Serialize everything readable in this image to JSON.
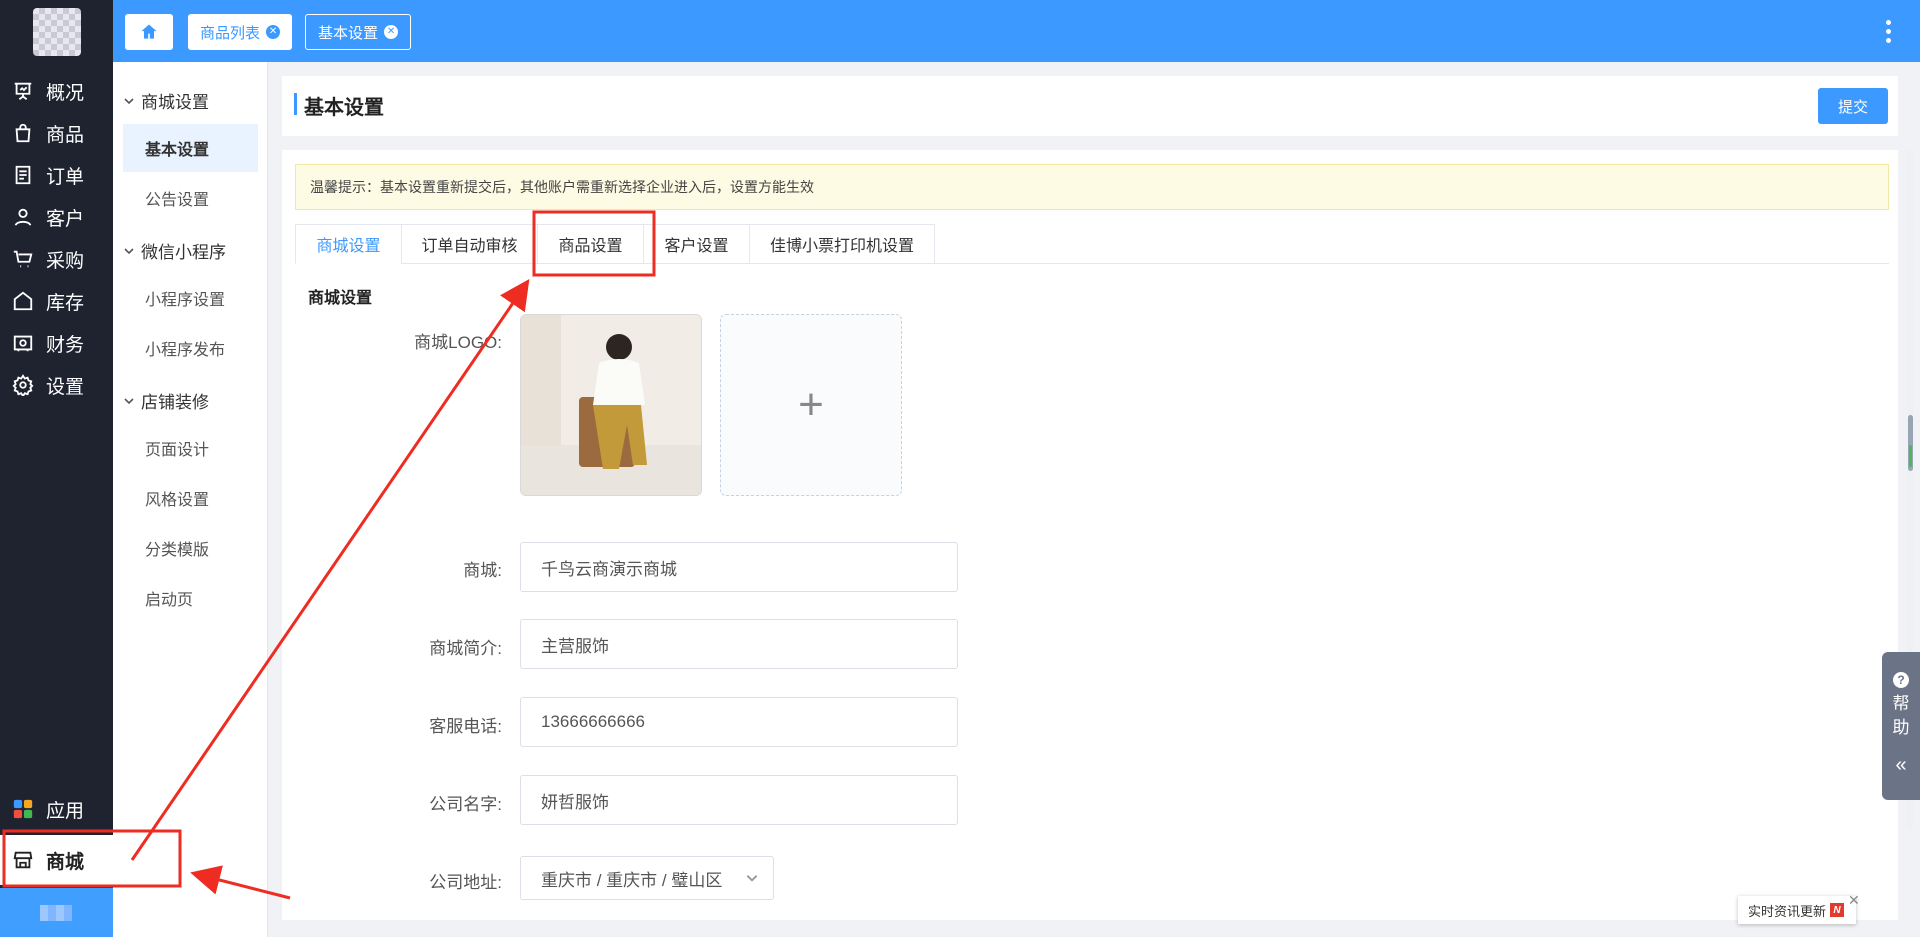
{
  "nav": {
    "items": [
      {
        "label": "概况",
        "icon": "presentation-icon"
      },
      {
        "label": "商品",
        "icon": "shopping-bag-icon"
      },
      {
        "label": "订单",
        "icon": "document-list-icon"
      },
      {
        "label": "客户",
        "icon": "user-icon"
      },
      {
        "label": "采购",
        "icon": "cart-icon"
      },
      {
        "label": "库存",
        "icon": "warehouse-icon"
      },
      {
        "label": "财务",
        "icon": "wallet-icon"
      },
      {
        "label": "设置",
        "icon": "gear-icon"
      }
    ],
    "apps_label": "应用",
    "mall_label": "商城"
  },
  "topbar": {
    "tabs": [
      {
        "label": "商品列表"
      },
      {
        "label": "基本设置"
      }
    ]
  },
  "submenu": {
    "groups": [
      {
        "label": "商城设置",
        "items": [
          "基本设置",
          "公告设置"
        ]
      },
      {
        "label": "微信小程序",
        "items": [
          "小程序设置",
          "小程序发布"
        ]
      },
      {
        "label": "店铺装修",
        "items": [
          "页面设计",
          "风格设置",
          "分类模版",
          "启动页"
        ]
      }
    ],
    "active_item": "基本设置"
  },
  "header": {
    "title": "基本设置",
    "submit_label": "提交"
  },
  "tip": "温馨提示：基本设置重新提交后，其他账户需重新选择企业进入后，设置方能生效",
  "tabs": [
    "商城设置",
    "订单自动审核",
    "商品设置",
    "客户设置",
    "佳博小票打印机设置"
  ],
  "active_tab": "商城设置",
  "form": {
    "section_title": "商城设置",
    "logo_label": "商城LOGO:",
    "shop_label": "商城:",
    "shop_value": "千鸟云商演示商城",
    "intro_label": "商城简介:",
    "intro_value": "主营服饰",
    "phone_label": "客服电话:",
    "phone_value": "13666666666",
    "company_label": "公司名字:",
    "company_value": "妍哲服饰",
    "address_label": "公司地址:",
    "address_value": "重庆市 / 重庆市 / 璧山区"
  },
  "help": {
    "label": "帮助"
  },
  "news": {
    "label": "实时资讯更新",
    "badge": "N"
  },
  "colors": {
    "primary": "#3b99ff",
    "nav_bg": "#1f2330",
    "annotation": "#ee2c22"
  }
}
